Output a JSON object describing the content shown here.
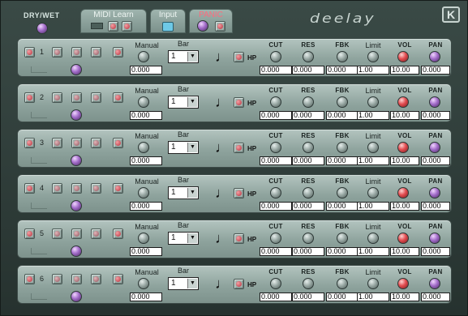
{
  "header": {
    "drywet_label": "DRY/WET",
    "tabs": [
      {
        "label": "MIDI Learn"
      },
      {
        "label": "Input"
      },
      {
        "label": "PANIC"
      }
    ],
    "logo_text": "deelay",
    "brand_badge": "K"
  },
  "columns": {
    "manual": "Manual",
    "bar": "Bar",
    "hp": "HP",
    "cut": "CUT",
    "res": "RES",
    "fbk": "FBK",
    "limit": "Limit",
    "vol": "VOL",
    "pan": "PAN"
  },
  "channels": [
    {
      "num": "1",
      "manual": "0.000",
      "bar": "1",
      "cut": "0.000",
      "res": "0.000",
      "fbk": "0.000",
      "limit": "1.00",
      "vol": "10.00",
      "pan": "0.000"
    },
    {
      "num": "2",
      "manual": "0.000",
      "bar": "1",
      "cut": "0.000",
      "res": "0.000",
      "fbk": "0.000",
      "limit": "1.00",
      "vol": "10.00",
      "pan": "0.000"
    },
    {
      "num": "3",
      "manual": "0.000",
      "bar": "1",
      "cut": "0.000",
      "res": "0.000",
      "fbk": "0.000",
      "limit": "1.00",
      "vol": "10.00",
      "pan": "0.000"
    },
    {
      "num": "4",
      "manual": "0.000",
      "bar": "1",
      "cut": "0.000",
      "res": "0.000",
      "fbk": "0.000",
      "limit": "1.00",
      "vol": "10.00",
      "pan": "0.000"
    },
    {
      "num": "5",
      "manual": "0.000",
      "bar": "1",
      "cut": "0.000",
      "res": "0.000",
      "fbk": "0.000",
      "limit": "1.00",
      "vol": "10.00",
      "pan": "0.000"
    },
    {
      "num": "6",
      "manual": "0.000",
      "bar": "1",
      "cut": "0.000",
      "res": "0.000",
      "fbk": "0.000",
      "limit": "1.00",
      "vol": "10.00",
      "pan": "0.000"
    }
  ],
  "icons": {
    "note": "music-note-icon",
    "knob": "knob-icon",
    "led": "led-button-icon"
  }
}
